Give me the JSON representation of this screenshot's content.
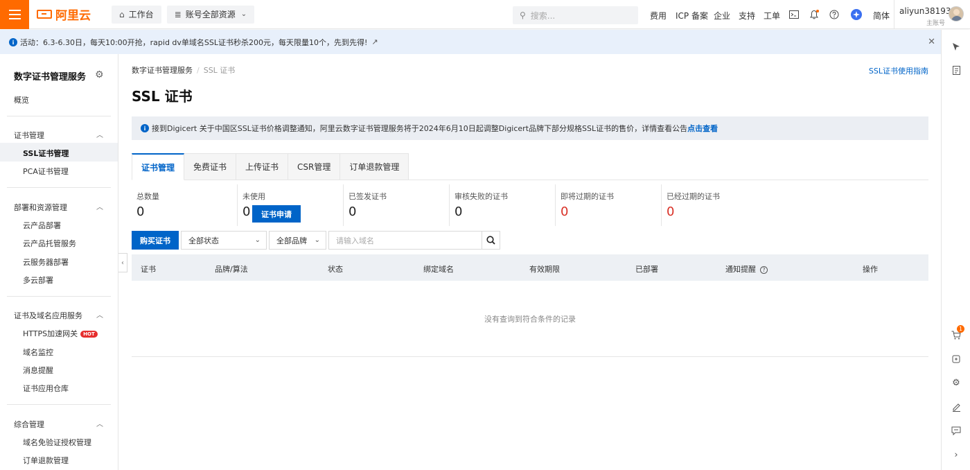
{
  "topbar": {
    "logo_text": "阿里云",
    "workbench": "工作台",
    "resources": "账号全部资源",
    "search_placeholder": "搜索...",
    "links": [
      "费用",
      "ICP 备案",
      "企业",
      "支持",
      "工单"
    ],
    "language": "简体",
    "user_name": "aliyun38193...",
    "user_role": "主账号"
  },
  "notice": {
    "text": "活动：6.3-6.30日，每天10:00开抢，rapid dv单域名SSL证书秒杀200元，每天限量10个，先到先得!"
  },
  "sidebar": {
    "title": "数字证书管理服务",
    "overview": "概览",
    "groups": [
      {
        "label": "证书管理",
        "items": [
          "SSL证书管理",
          "PCA证书管理"
        ]
      },
      {
        "label": "部署和资源管理",
        "items": [
          "云产品部署",
          "云产品托管服务",
          "云服务器部署",
          "多云部署"
        ]
      },
      {
        "label": "证书及域名应用服务",
        "items": [
          "HTTPS加速网关",
          "域名监控",
          "消息提醒",
          "证书应用仓库"
        ]
      },
      {
        "label": "综合管理",
        "items": [
          "域名免验证授权管理",
          "订单退款管理"
        ]
      }
    ],
    "hot_badge": "HOT"
  },
  "main": {
    "breadcrumb": [
      "数字证书管理服务",
      "SSL 证书"
    ],
    "guide_link": "SSL证书使用指南",
    "title": "SSL 证书",
    "alert_text": "接到Digicert 关于中国区SSL证书价格调整通知，阿里云数字证书管理服务将于2024年6月10日起调整Digicert品牌下部分规格SSL证书的售价，详情查看公告",
    "alert_link": "点击查看",
    "tabs": [
      "证书管理",
      "免费证书",
      "上传证书",
      "CSR管理",
      "订单退款管理"
    ],
    "stats": [
      {
        "label": "总数量",
        "value": "0"
      },
      {
        "label": "未使用",
        "value": "0"
      },
      {
        "label": "已签发证书",
        "value": "0"
      },
      {
        "label": "审核失败的证书",
        "value": "0"
      },
      {
        "label": "即将过期的证书",
        "value": "0"
      },
      {
        "label": "已经过期的证书",
        "value": "0"
      }
    ],
    "apply_button": "证书申请",
    "buy_button": "购买证书",
    "status_select": "全部状态",
    "brand_select": "全部品牌",
    "domain_placeholder": "请输入域名",
    "table_headers": [
      "证书",
      "品牌/算法",
      "状态",
      "绑定域名",
      "有效期限",
      "已部署",
      "通知提醒",
      "操作"
    ],
    "empty_text": "没有查询到符合条件的记录"
  },
  "rail": {
    "cart_count": "1"
  },
  "colors": {
    "brand": "#ff6a00",
    "primary": "#0064c8",
    "danger": "#d93026"
  }
}
